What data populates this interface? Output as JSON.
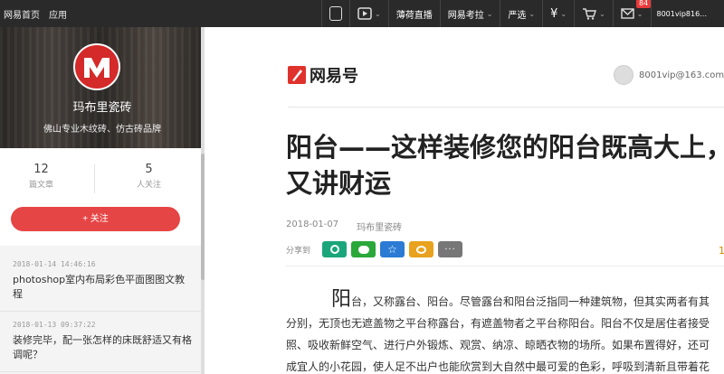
{
  "topbar": {
    "home": "网易首页",
    "apps": "应用",
    "items": [
      "薄荷直播",
      "网易考拉",
      "严选"
    ],
    "badge": "84",
    "user": "8001vip816…"
  },
  "sidebar": {
    "account_name": "玛布里瓷砖",
    "account_desc": "佛山专业木纹砖、仿古砖品牌",
    "stats": [
      {
        "num": "12",
        "label": "篇文章"
      },
      {
        "num": "5",
        "label": "人关注"
      }
    ],
    "follow_label": "+ 关注",
    "articles": [
      {
        "date": "2018-01-14 14:46:16",
        "title": "photoshop室内布局彩色平面图图文教程"
      },
      {
        "date": "2018-01-13 09:37:22",
        "title": "装修完毕，配一张怎样的床既舒适又有格调呢？"
      }
    ]
  },
  "main": {
    "brand": "网易号",
    "user_email": "8001vip@163.com",
    "headline": "阳台——这样装修您的阳台既高大上，又讲财运",
    "date": "2018-01-07",
    "source": "玛布里瓷砖",
    "share_label": "分享到",
    "share_count": "1",
    "dropcap": "阳",
    "body_lines": [
      "台，又称露台、阳台。尽管露台和阳台泛指同一种建筑物，但其实两者有其",
      "分别，无顶也无遮盖物之平台称露台，有遮盖物者之平台称阳台。阳台不仅是居住者接受",
      "照、吸收新鲜空气、进行户外锻炼、观赏、纳凉、晾晒衣物的场所。如果布置得好，还可",
      "成宜人的小花园，使人足不出户也能欣赏到大自然中最可爱的色彩，呼吸到清新且带着花"
    ]
  },
  "colors": {
    "topbar": "#2a2a2a",
    "accent": "#e64545",
    "brand": "#e0322c",
    "share_qq": "#1aa67a",
    "share_wechat": "#2aa83a",
    "share_qzone": "#2b7bd4",
    "share_weibo": "#e8a21d",
    "share_more": "#777777"
  }
}
